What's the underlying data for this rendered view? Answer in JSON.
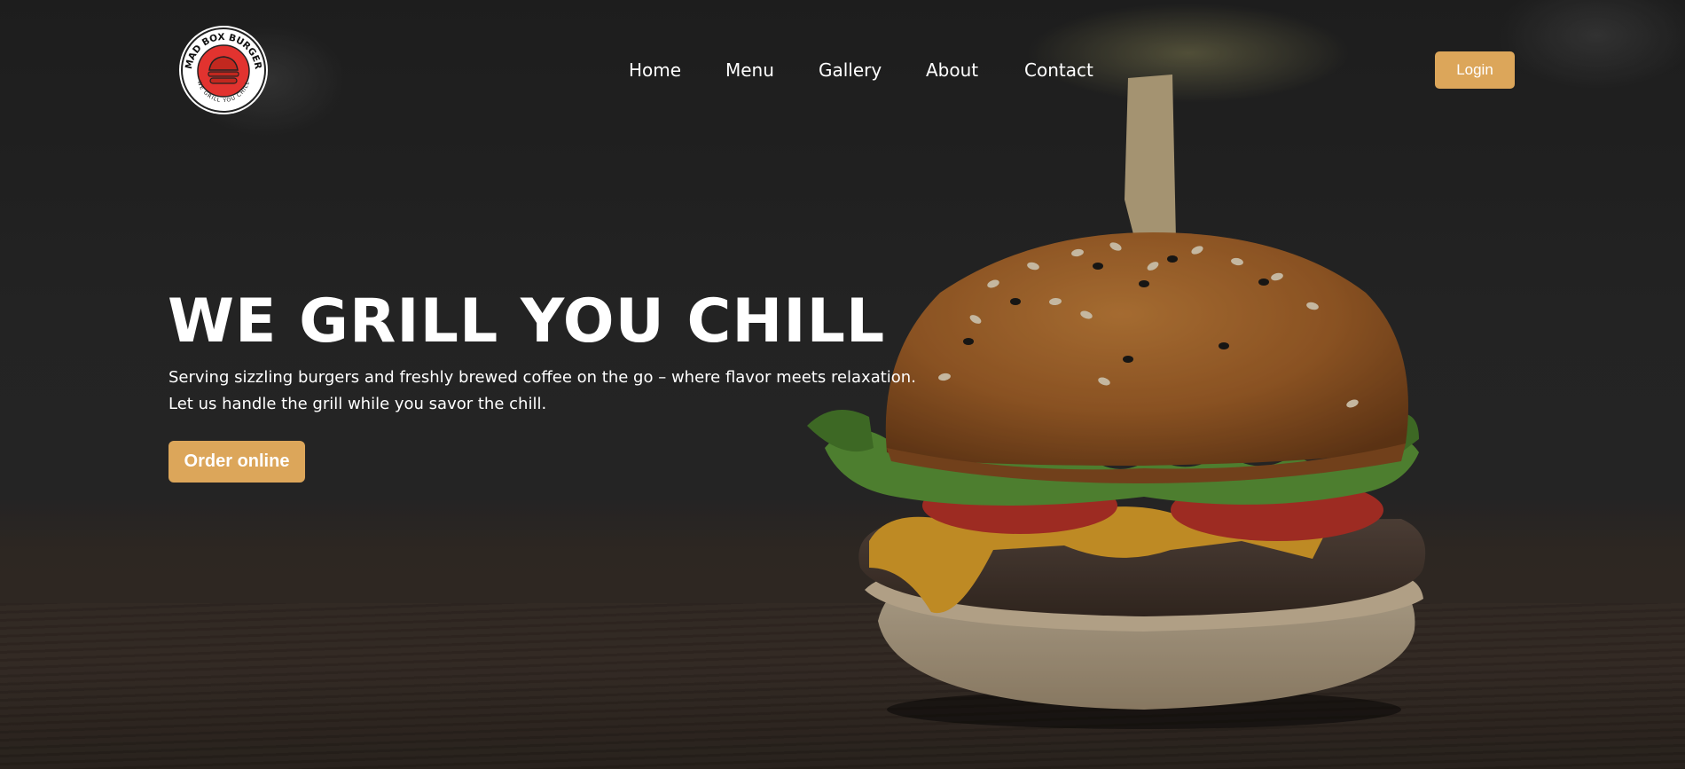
{
  "brand": {
    "logo_top_text": "MAD BOX BURGER",
    "logo_bottom_text": "WE GRILL YOU CHILL",
    "colors": {
      "accent": "#dca65a",
      "logo_red": "#e2332f",
      "text": "#ffffff"
    }
  },
  "nav": {
    "items": [
      {
        "label": "Home"
      },
      {
        "label": "Menu"
      },
      {
        "label": "Gallery"
      },
      {
        "label": "About"
      },
      {
        "label": "Contact"
      }
    ],
    "login_label": "Login"
  },
  "hero": {
    "headline": "WE GRILL YOU CHILL",
    "subtext_line1": "Serving sizzling burgers and freshly brewed coffee on the go – where flavor meets relaxation.",
    "subtext_line2": "Let us handle the grill while you savor the chill.",
    "cta_label": "Order online",
    "background_image": "burger"
  }
}
